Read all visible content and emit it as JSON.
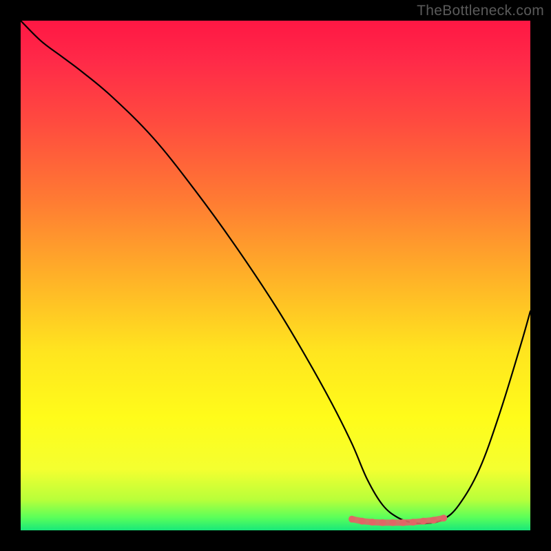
{
  "watermark": "TheBottleneck.com",
  "chart_data": {
    "type": "line",
    "title": "",
    "xlabel": "",
    "ylabel": "",
    "xlim": [
      0,
      100
    ],
    "ylim": [
      0,
      100
    ],
    "gradient_stops": [
      {
        "offset": 0.0,
        "color": "#ff1744"
      },
      {
        "offset": 0.08,
        "color": "#ff2a48"
      },
      {
        "offset": 0.2,
        "color": "#ff4b3f"
      },
      {
        "offset": 0.35,
        "color": "#ff7a33"
      },
      {
        "offset": 0.5,
        "color": "#ffb028"
      },
      {
        "offset": 0.65,
        "color": "#ffe51f"
      },
      {
        "offset": 0.78,
        "color": "#fffc1a"
      },
      {
        "offset": 0.88,
        "color": "#f4ff30"
      },
      {
        "offset": 0.94,
        "color": "#b8ff3a"
      },
      {
        "offset": 0.975,
        "color": "#5aff5a"
      },
      {
        "offset": 1.0,
        "color": "#18e87a"
      }
    ],
    "series": [
      {
        "name": "curve",
        "type": "line",
        "color": "#000000",
        "x": [
          0,
          4,
          8,
          12,
          18,
          26,
          34,
          42,
          50,
          56,
          61,
          65,
          68,
          71,
          74,
          77,
          80,
          83,
          86,
          90,
          94,
          98,
          100
        ],
        "y": [
          100,
          96,
          93,
          90,
          85,
          77,
          67,
          56,
          44,
          34,
          25,
          17,
          10,
          5,
          2.5,
          1.5,
          1.4,
          2.2,
          5,
          12,
          23,
          36,
          43
        ]
      },
      {
        "name": "optimal-band",
        "type": "marker",
        "color": "#e06666",
        "x": [
          65,
          67,
          69,
          71,
          73,
          75,
          77,
          79,
          81,
          83
        ],
        "y": [
          2.2,
          1.8,
          1.6,
          1.5,
          1.5,
          1.5,
          1.6,
          1.8,
          2.0,
          2.4
        ]
      }
    ]
  }
}
